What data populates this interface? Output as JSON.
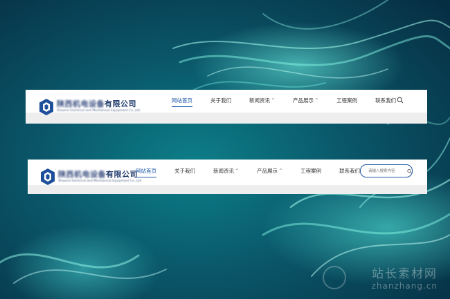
{
  "brand": {
    "company_cn_blurred": "陕西机电设备",
    "company_cn_suffix": "有限公司",
    "company_en": "Shaanxi Electrical and Mechanical Equipment Co.,Ltd."
  },
  "nav_primary": {
    "items": [
      {
        "label": "网站首页"
      },
      {
        "label": "关于我们"
      },
      {
        "label": "新闻资讯",
        "caret": "^"
      },
      {
        "label": "产品展示",
        "caret": "^"
      },
      {
        "label": "工程案例"
      },
      {
        "label": "联系我们"
      }
    ]
  },
  "nav_secondary": {
    "items": [
      {
        "label": "网站首页"
      },
      {
        "label": "关于我们"
      },
      {
        "label": "新闻资讯",
        "caret": "^"
      },
      {
        "label": "产品展示",
        "caret": "^"
      },
      {
        "label": "工程案例"
      },
      {
        "label": "联系我们"
      }
    ],
    "search_placeholder": "请输入搜索内容"
  },
  "icons": {
    "search": "search-icon",
    "logo": "logo-icon"
  },
  "watermark": {
    "cn": "站长素材网",
    "en": "zhanzhang.cn"
  },
  "colors": {
    "accent": "#1a55a8",
    "background_teal": "#0c7f88",
    "background_dark": "#062a3f"
  }
}
